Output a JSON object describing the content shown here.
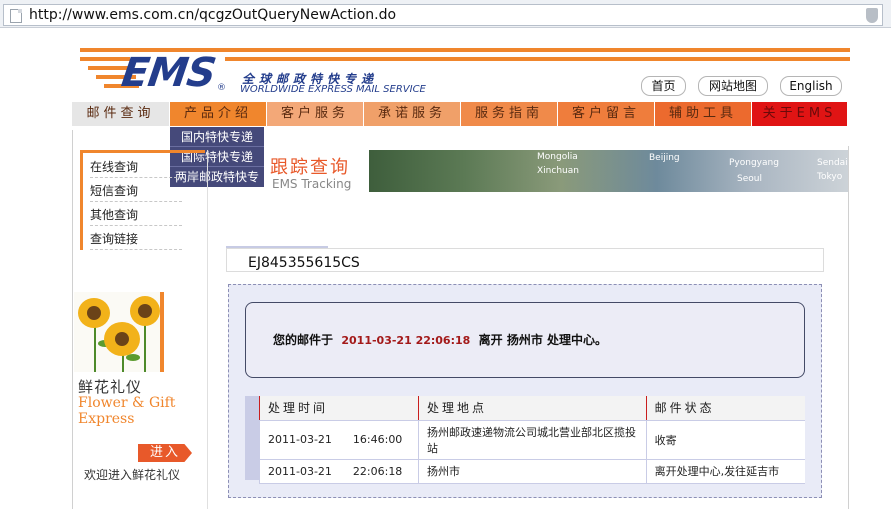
{
  "browser": {
    "url": "http://www.ems.com.cn/qcgzOutQueryNewAction.do"
  },
  "header": {
    "logo": "EMS",
    "logo_reg": "®",
    "tagline_cn": "全球邮政特快专递",
    "tagline_en": "WORLDWIDE EXPRESS MAIL SERVICE",
    "links": [
      "首页",
      "网站地图",
      "English"
    ]
  },
  "nav": {
    "items": [
      {
        "label": "邮件查询",
        "color": "#e6e6e6"
      },
      {
        "label": "产品介绍",
        "color": "#f0862d"
      },
      {
        "label": "客户服务",
        "color": "#f3a878"
      },
      {
        "label": "承诺服务",
        "color": "#f0a069"
      },
      {
        "label": "服务指南",
        "color": "#f08a4a"
      },
      {
        "label": "客户留言",
        "color": "#ef7d3c"
      },
      {
        "label": "辅助工具",
        "color": "#ec6a2e"
      },
      {
        "label": "关于EMS",
        "color": "#e01414"
      }
    ],
    "dropdown": [
      "国内特快专递",
      "国际特快专递",
      "两岸邮政特快专"
    ]
  },
  "sidebar": {
    "items": [
      "在线查询",
      "短信查询",
      "其他查询",
      "查询链接"
    ]
  },
  "banner": {
    "title": "跟踪查询",
    "subtitle": "EMS Tracking",
    "map_labels": [
      "Beijing",
      "Pyongyang",
      "Seoul",
      "Tokyo",
      "Xinchuan",
      "Mongolia",
      "Sendai"
    ]
  },
  "ad": {
    "title_cn": "鲜花礼仪",
    "title_en_1": "Flower & Gift",
    "title_en_2": "Express",
    "button": "进入",
    "link": "欢迎进入鲜花礼仪"
  },
  "tracking": {
    "number": "EJ845355615CS",
    "message_prefix": "您的邮件于",
    "message_time": "2011-03-21 22:06:18",
    "message_suffix": "离开  扬州市  处理中心。",
    "columns": [
      "处理时间",
      "处理地点",
      "邮件状态"
    ],
    "rows": [
      {
        "time": "2011-03-21      16:46:00",
        "place": "扬州邮政速递物流公司城北营业部北区揽投站",
        "status": "收寄"
      },
      {
        "time": "2011-03-21      22:06:18",
        "place": "扬州市",
        "status": "离开处理中心,发往延吉市"
      }
    ]
  }
}
